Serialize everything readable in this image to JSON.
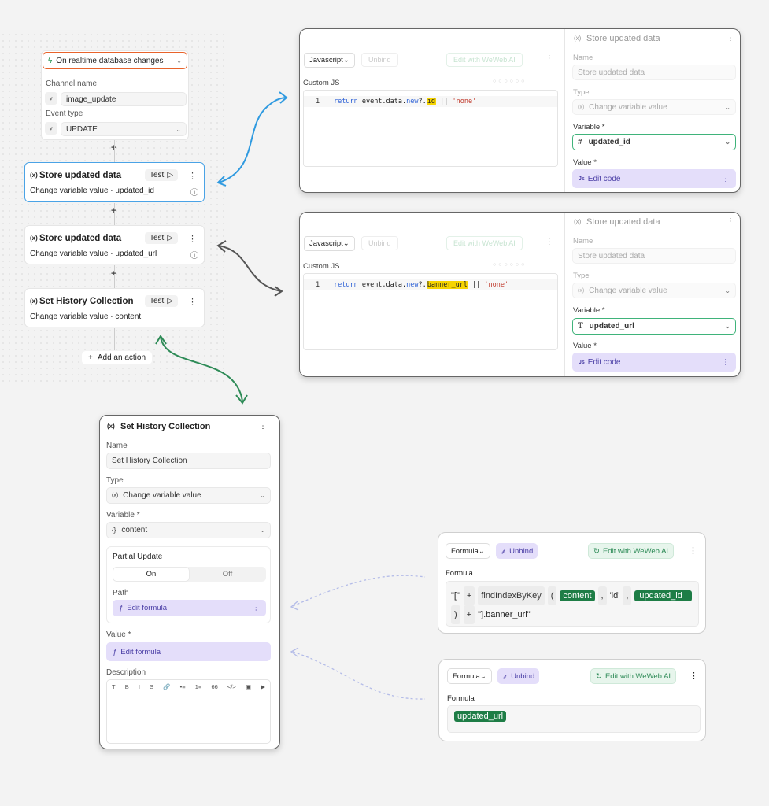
{
  "workflow": {
    "trigger": {
      "label": "On realtime database changes"
    },
    "channel_name_label": "Channel name",
    "channel_name_value": "image_update",
    "event_type_label": "Event type",
    "event_type_value": "UPDATE",
    "actions": [
      {
        "title": "Store updated data",
        "subtitle": "Change variable value · updated_id",
        "test": "Test"
      },
      {
        "title": "Store updated data",
        "subtitle": "Change variable value · updated_url",
        "test": "Test"
      },
      {
        "title": "Set History Collection",
        "subtitle": "Change variable value · content",
        "test": "Test"
      }
    ],
    "add_action": "Add an action"
  },
  "panel1": {
    "lang": "Javascript",
    "unbind": "Unbind",
    "edit_ai": "Edit with WeWeb AI",
    "custom_js": "Custom JS",
    "line_no": "1",
    "code_return": "return",
    "code_mid": " event.data.",
    "code_new": "new",
    "code_q": "?.",
    "code_key": "id",
    "code_or": " || ",
    "code_str": "'none'",
    "side_title": "Store updated data",
    "name_label": "Name",
    "name_value": "Store updated data",
    "type_label": "Type",
    "type_value": "Change variable value",
    "variable_label": "Variable *",
    "variable_value": "updated_id",
    "variable_icon": "#",
    "value_label": "Value *",
    "edit_code": "Edit code"
  },
  "panel2": {
    "lang": "Javascript",
    "unbind": "Unbind",
    "edit_ai": "Edit with WeWeb AI",
    "custom_js": "Custom JS",
    "line_no": "1",
    "code_return": "return",
    "code_mid": " event.data.",
    "code_new": "new",
    "code_q": "?.",
    "code_key": "banner_url",
    "code_or": " || ",
    "code_str": "'none'",
    "side_title": "Store updated data",
    "name_label": "Name",
    "name_value": "Store updated data",
    "type_label": "Type",
    "type_value": "Change variable value",
    "variable_label": "Variable *",
    "variable_value": "updated_url",
    "variable_icon": "T",
    "value_label": "Value *",
    "edit_code": "Edit code"
  },
  "history": {
    "title": "Set History Collection",
    "name_label": "Name",
    "name_value": "Set History Collection",
    "type_label": "Type",
    "type_value": "Change variable value",
    "variable_label": "Variable *",
    "variable_value": "content",
    "partial_update": "Partial Update",
    "on": "On",
    "off": "Off",
    "path_label": "Path",
    "edit_formula": "Edit formula",
    "value_label": "Value *",
    "value_formula": "Edit formula",
    "description_label": "Description",
    "toolbar": [
      "T",
      "B",
      "I",
      "S",
      "🔗",
      "•≡",
      "1≡",
      "66",
      "</>",
      "▣",
      "▶"
    ]
  },
  "formula1": {
    "mode": "Formula",
    "unbind": "Unbind",
    "edit_ai": "Edit with WeWeb AI",
    "label": "Formula",
    "t1": "\"[\"",
    "t2": "+",
    "t3": "findIndexByKey",
    "t4": "(",
    "t5": "content",
    "t6": ",",
    "t7": "'id'",
    "t8": ",",
    "t9": "updated_id",
    "t10": ")",
    "t11": "+",
    "t12": "\"].banner_url\""
  },
  "formula2": {
    "mode": "Formula",
    "unbind": "Unbind",
    "edit_ai": "Edit with WeWeb AI",
    "label": "Formula",
    "t1": "updated_url"
  },
  "colors": {
    "blue": "#2f9ae0",
    "gray": "#555555",
    "green": "#2e8b57",
    "orange": "#e8632b"
  }
}
